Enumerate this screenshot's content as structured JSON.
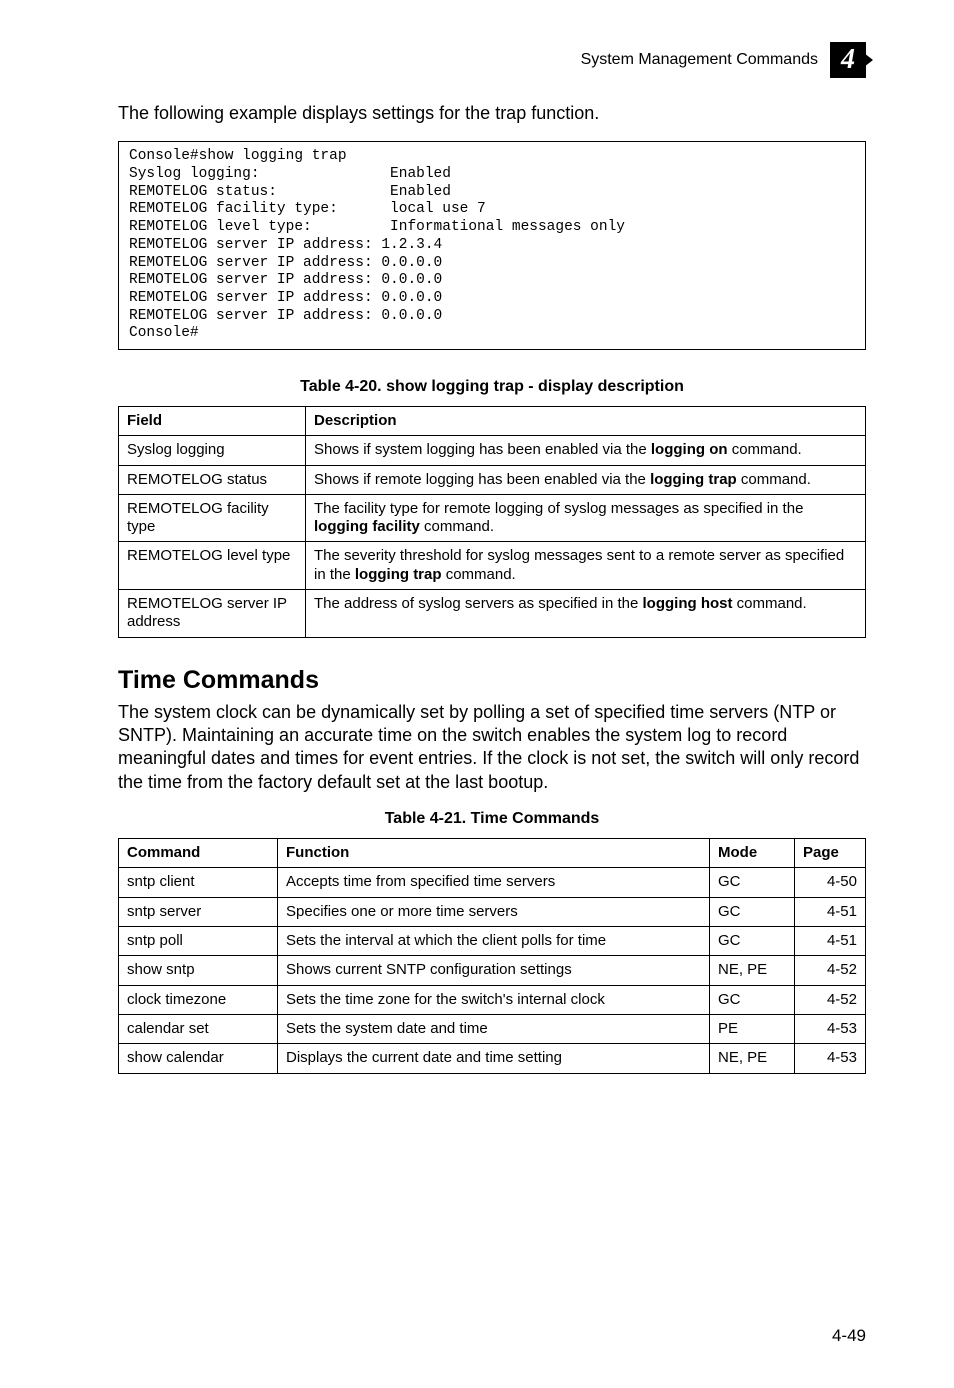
{
  "header": {
    "section_title": "System Management Commands",
    "four_glyph": "4"
  },
  "intro1": "The following example displays settings for the trap function.",
  "console_lines": [
    "Console#show logging trap",
    "Syslog logging:               Enabled",
    "REMOTELOG status:             Enabled",
    "REMOTELOG facility type:      local use 7",
    "REMOTELOG level type:         Informational messages only",
    "REMOTELOG server IP address: 1.2.3.4",
    "REMOTELOG server IP address: 0.0.0.0",
    "REMOTELOG server IP address: 0.0.0.0",
    "REMOTELOG server IP address: 0.0.0.0",
    "REMOTELOG server IP address: 0.0.0.0",
    "Console#"
  ],
  "table20": {
    "caption": "Table 4-20.   show logging trap - display description",
    "head_field": "Field",
    "head_desc": "Description",
    "rows": [
      {
        "field": "Syslog logging",
        "desc_pre": "Shows if system logging has been enabled via the ",
        "desc_bold": "logging on",
        "desc_post": " command."
      },
      {
        "field": "REMOTELOG status",
        "desc_pre": "Shows if remote logging has been enabled via the ",
        "desc_bold": "logging trap",
        "desc_post": " command."
      },
      {
        "field": "REMOTELOG facility type",
        "desc_pre": "The facility type for remote logging of syslog messages as specified in the ",
        "desc_bold": "logging facility",
        "desc_post": " command."
      },
      {
        "field": "REMOTELOG level type",
        "desc_pre": "The severity threshold for syslog messages sent to a remote server as specified in the ",
        "desc_bold": "logging trap",
        "desc_post": " command."
      },
      {
        "field": "REMOTELOG server IP address",
        "desc_pre": "The address of syslog servers as specified in the ",
        "desc_bold": "logging host",
        "desc_post": " command."
      }
    ]
  },
  "time_section": {
    "heading": "Time Commands",
    "para": "The system clock can be dynamically set by polling a set of specified time servers (NTP or SNTP). Maintaining an accurate time on the switch enables the system log to record meaningful dates and times for event entries. If the clock is not set, the switch will only record the time from the factory default set at the last bootup."
  },
  "table21": {
    "caption": "Table 4-21.   Time Commands",
    "head_cmd": "Command",
    "head_fn": "Function",
    "head_mode": "Mode",
    "head_page": "Page",
    "rows": [
      {
        "cmd": "sntp client",
        "fn": "Accepts time from specified time servers",
        "mode": "GC",
        "page": "4-50"
      },
      {
        "cmd": "sntp server",
        "fn": "Specifies one or more time servers",
        "mode": "GC",
        "page": "4-51"
      },
      {
        "cmd": "sntp poll",
        "fn": "Sets the interval at which the client polls for time",
        "mode": "GC",
        "page": "4-51"
      },
      {
        "cmd": "show sntp",
        "fn": "Shows current SNTP configuration settings",
        "mode": "NE, PE",
        "page": "4-52"
      },
      {
        "cmd": "clock timezone",
        "fn": "Sets the time zone for the switch's internal clock",
        "mode": "GC",
        "page": "4-52"
      },
      {
        "cmd": "calendar set",
        "fn": "Sets the system date and time",
        "mode": "PE",
        "page": "4-53"
      },
      {
        "cmd": "show calendar",
        "fn": "Displays the current date and time setting",
        "mode": "NE, PE",
        "page": "4-53"
      }
    ]
  },
  "footer_page": "4-49"
}
